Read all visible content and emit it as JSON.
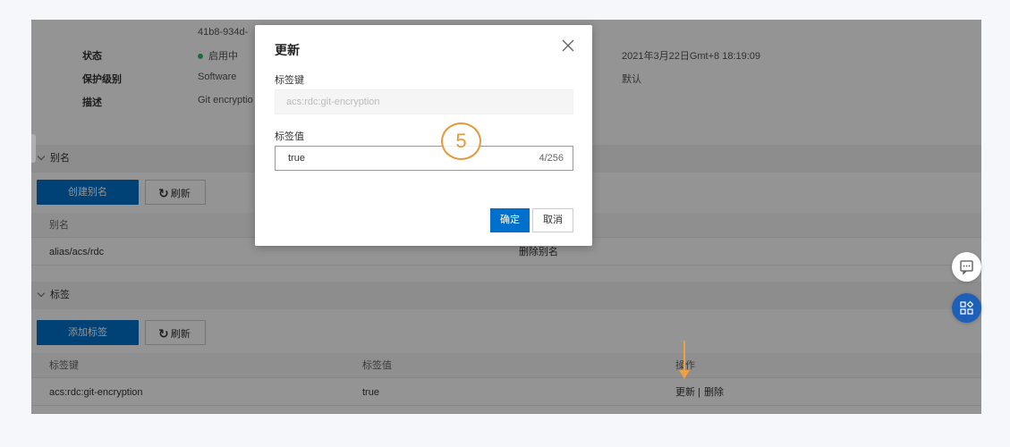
{
  "info": {
    "key_id_partial": "41b8-934d-",
    "status_label": "状态",
    "status_value": "启用中",
    "protection_label": "保护级别",
    "protection_value": "Software",
    "desc_label": "描述",
    "desc_value": "Git encryptio",
    "date_value": "2021年3月22日Gmt+8 18:19:09",
    "default_value": "默认"
  },
  "alias": {
    "section_title": "别名",
    "create_button": "创建别名",
    "refresh_button": "刷新",
    "column_alias": "别名",
    "row_alias": "alias/acs/rdc",
    "row_action": "删除别名"
  },
  "tags": {
    "section_title": "标签",
    "add_button": "添加标签",
    "refresh_button": "刷新",
    "columns": [
      "标签键",
      "标签值",
      "操作"
    ],
    "rows": [
      {
        "key": "acs:rdc:git-encryption",
        "value": "true",
        "update": "更新",
        "divider": "|",
        "delete": "删除"
      }
    ]
  },
  "modal": {
    "title": "更新",
    "key_label": "标签键",
    "key_value": "acs:rdc:git-encryption",
    "value_label": "标签值",
    "value_value": "true",
    "value_counter": "4/256",
    "ok_button": "确定",
    "cancel_button": "取消"
  },
  "annotation": {
    "step_number": "5",
    "accent_color": "#e39a3b"
  },
  "icons": {
    "close": "close-icon",
    "refresh": "refresh-icon",
    "chat": "chat-icon",
    "apps": "apps-icon"
  },
  "colors": {
    "primary": "#0070cc",
    "status_dot": "#2bbf5f",
    "fab": "#1e5fb8"
  }
}
